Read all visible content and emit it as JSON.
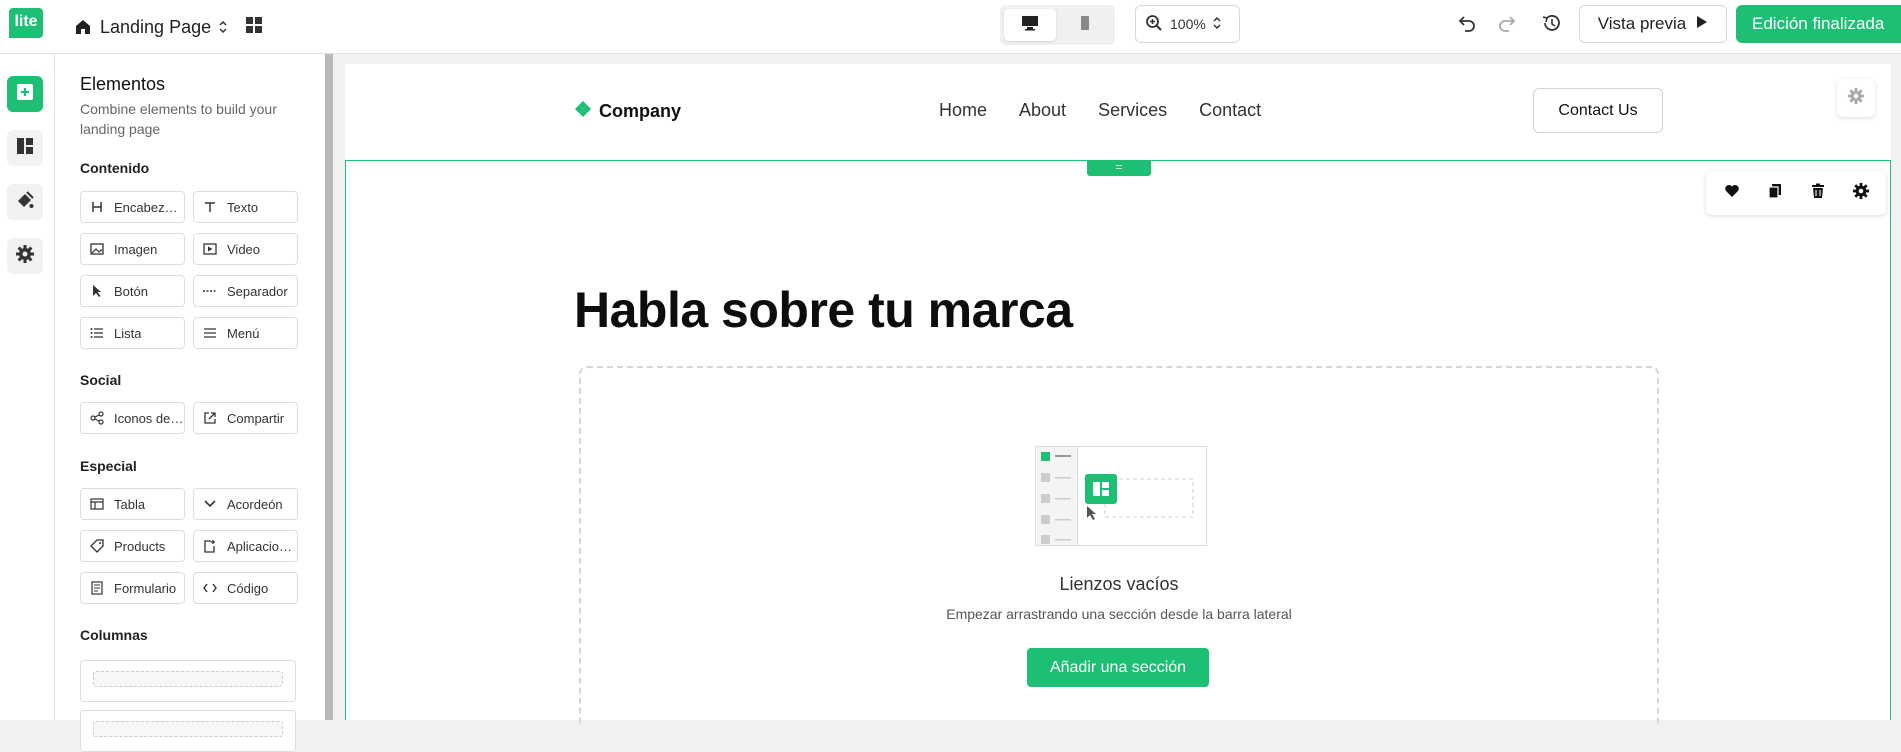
{
  "topbar": {
    "logo_text": "lite",
    "page_name": "Landing Page",
    "zoom_value": "100%",
    "preview_label": "Vista previa",
    "done_label": "Edición finalizada",
    "accent_color": "#1cbf73",
    "icons": [
      "home-icon",
      "chevron-updown-icon",
      "grid-icon",
      "desktop-icon",
      "mobile-icon",
      "zoom-in-icon",
      "undo-icon",
      "redo-icon",
      "history-icon",
      "play-icon"
    ]
  },
  "rail": {
    "items": [
      {
        "icon": "add-element-icon",
        "active": true
      },
      {
        "icon": "layout-icon",
        "active": false
      },
      {
        "icon": "paint-icon",
        "active": false
      },
      {
        "icon": "settings-icon",
        "active": false
      }
    ]
  },
  "panel": {
    "title": "Elementos",
    "description": "Combine elements to build your landing page",
    "sections": {
      "contenido": {
        "title": "Contenido",
        "items": [
          "Encabezado",
          "Texto",
          "Imagen",
          "Video",
          "Botón",
          "Separador",
          "Lista",
          "Menú"
        ]
      },
      "social": {
        "title": "Social",
        "items": [
          "Iconos de redes",
          "Compartir"
        ]
      },
      "especial": {
        "title": "Especial",
        "items": [
          "Tabla",
          "Acordeón",
          "Products",
          "Aplicaciones",
          "Formulario",
          "Código"
        ]
      },
      "columnas": {
        "title": "Columnas"
      }
    }
  },
  "canvas": {
    "brand": "Company",
    "nav": [
      "Home",
      "About",
      "Services",
      "Contact"
    ],
    "contact_button": "Contact Us",
    "section_handle": "=",
    "headline": "Habla sobre tu marca",
    "empty_title": "Lienzos vacíos",
    "empty_subtitle": "Empezar arrastrando una sección desde la barra lateral",
    "add_section_button": "Añadir una sección",
    "toolbar_icons": [
      "heart-icon",
      "copy-icon",
      "trash-icon",
      "settings-icon"
    ]
  }
}
